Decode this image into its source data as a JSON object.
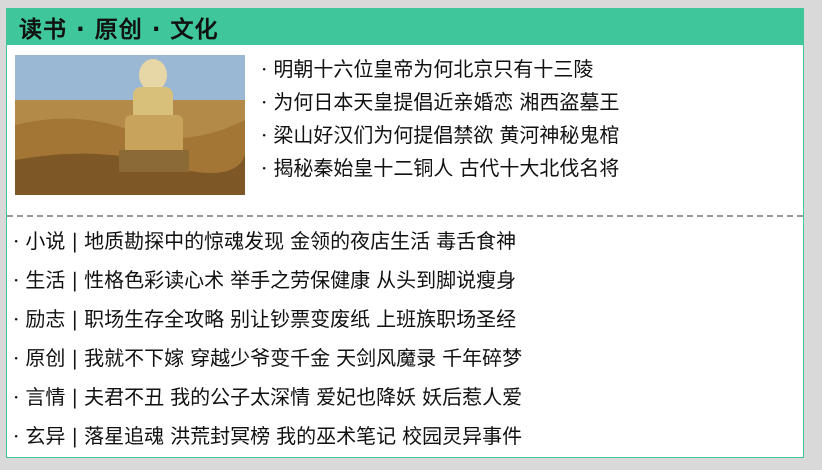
{
  "header": {
    "title": "读书 · 原创 · 文化"
  },
  "featured": {
    "links": [
      [
        "明朝十六位皇帝为何北京只有十三陵"
      ],
      [
        "为何日本天皇提倡近亲婚恋",
        "湘西盗墓王"
      ],
      [
        "梁山好汉们为何提倡禁欲",
        "黄河神秘鬼棺"
      ],
      [
        "揭秘秦始皇十二铜人",
        "古代十大北伐名将"
      ]
    ]
  },
  "categories": [
    {
      "name": "小说",
      "links": [
        "地质勘探中的惊魂发现",
        "金领的夜店生活",
        "毒舌食神"
      ]
    },
    {
      "name": "生活",
      "links": [
        "性格色彩读心术",
        "举手之劳保健康",
        "从头到脚说瘦身"
      ]
    },
    {
      "name": "励志",
      "links": [
        "职场生存全攻略",
        "别让钞票变废纸",
        "上班族职场圣经"
      ]
    },
    {
      "name": "原创",
      "links": [
        "我就不下嫁",
        "穿越少爷变千金",
        "天剑风魔录",
        "千年碎梦"
      ]
    },
    {
      "name": "言情",
      "links": [
        "夫君不丑",
        "我的公子太深情",
        "爱妃也降妖",
        "妖后惹人爱"
      ]
    },
    {
      "name": "玄异",
      "links": [
        "落星追魂",
        "洪荒封冥榜",
        "我的巫术笔记",
        "校园灵异事件"
      ]
    }
  ],
  "symbols": {
    "bullet": "·",
    "separator": "|"
  },
  "colors": {
    "accent": "#3fc79b",
    "divider": "#9a9a9a"
  }
}
